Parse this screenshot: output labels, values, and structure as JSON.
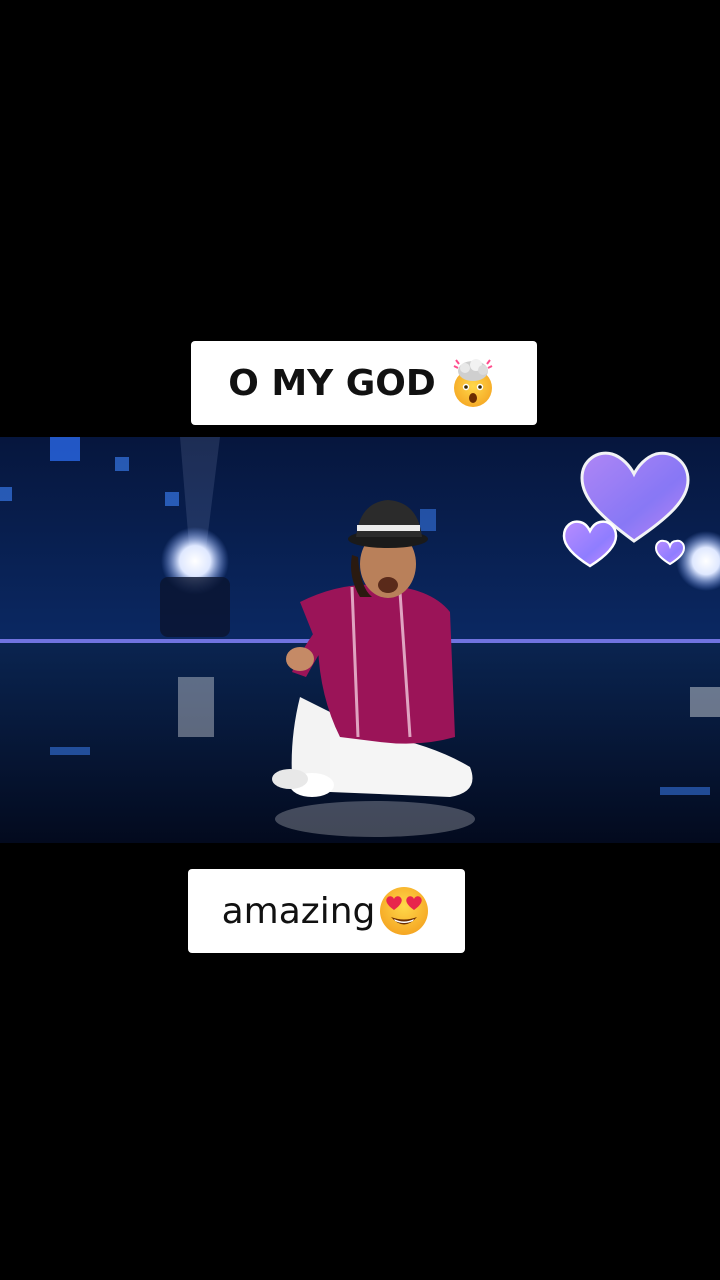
{
  "captions": {
    "top": {
      "text": "O MY GOD",
      "emoji": "exploding-head-emoji"
    },
    "bottom": {
      "text": "amazing",
      "emoji": "heart-eyes-emoji"
    }
  },
  "video": {
    "scene": "dance-stage-performance",
    "overlay_icon": "purple-hearts-sticker"
  },
  "colors": {
    "background": "#000000",
    "caption_bg": "#ffffff",
    "caption_text": "#111111",
    "stage_blue": "#0b2a66",
    "kurta": "#9b1458",
    "heart_gradient_start": "#b88cff",
    "heart_gradient_end": "#7f7bff"
  }
}
